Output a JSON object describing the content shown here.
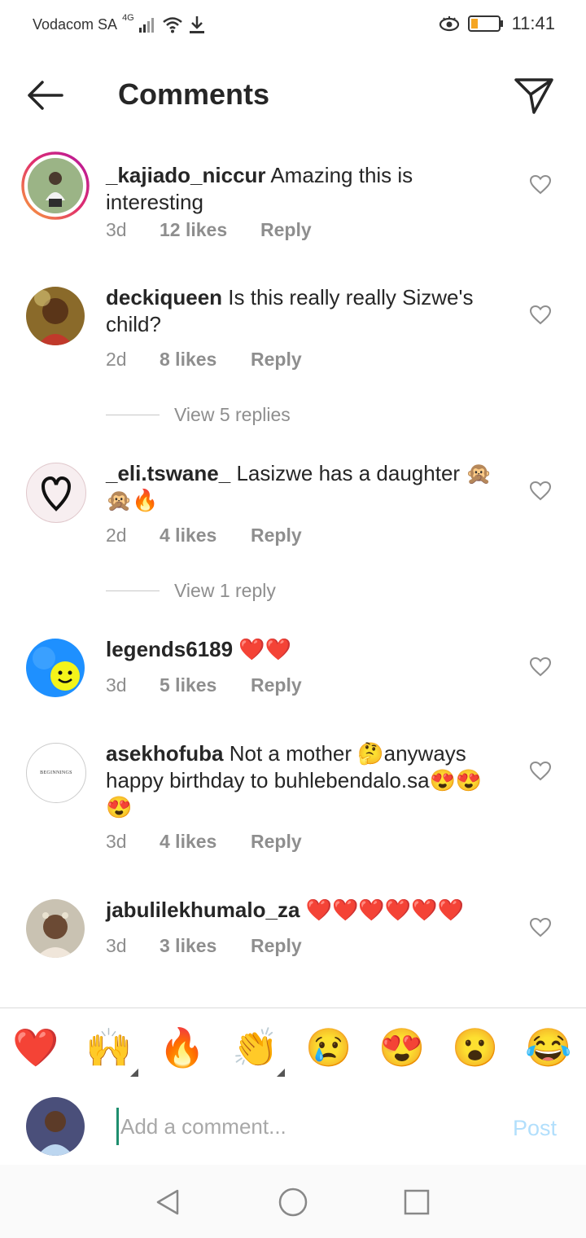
{
  "status": {
    "carrier": "Vodacom SA",
    "network": "4G",
    "time": "11:41"
  },
  "header": {
    "title": "Comments",
    "back_icon": "arrow-left-icon",
    "share_icon": "paper-plane-icon"
  },
  "comments": [
    {
      "username": "_kajiado_niccur",
      "text": "Amazing this is interesting",
      "time": "3d",
      "likes": "12 likes",
      "reply": "Reply"
    },
    {
      "username": "deckiqueen",
      "text": "Is this really really Sizwe's child?",
      "time": "2d",
      "likes": "8 likes",
      "reply": "Reply",
      "view_replies": "View 5 replies"
    },
    {
      "username": "_eli.tswane_",
      "text": "Lasizwe has a daughter 🙊🙊🔥",
      "time": "2d",
      "likes": "4 likes",
      "reply": "Reply",
      "view_replies": "View 1 reply"
    },
    {
      "username": "legends6189",
      "text": "❤️❤️",
      "time": "3d",
      "likes": "5 likes",
      "reply": "Reply"
    },
    {
      "username": "asekhofuba",
      "text": "Not a mother 🤔anyways happy birthday to buhlebendalo.sa😍😍😍",
      "time": "3d",
      "likes": "4 likes",
      "reply": "Reply",
      "avatar_text": "BEGINNINGS"
    },
    {
      "username": "jabulilekhumalo_za",
      "text": "❤️❤️❤️❤️❤️❤️",
      "time": "3d",
      "likes": "3 likes",
      "reply": "Reply"
    }
  ],
  "emoji_bar": [
    "❤️",
    "🙌",
    "🔥",
    "👏",
    "😢",
    "😍",
    "😮",
    "😂"
  ],
  "compose": {
    "placeholder": "Add a comment...",
    "post_label": "Post"
  }
}
